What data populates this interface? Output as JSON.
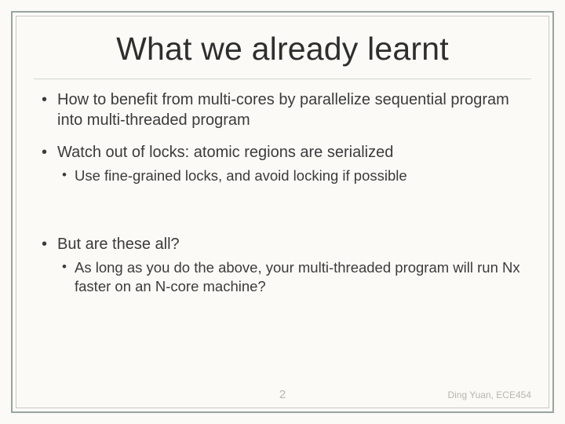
{
  "title": "What we already learnt",
  "bullets": {
    "b1": "How to benefit from multi-cores by parallelize sequential program into multi-threaded program",
    "b2": "Watch out of locks: atomic regions are serialized",
    "b2_sub1": "Use fine-grained locks, and avoid locking if possible",
    "b3": "But are these all?",
    "b3_sub1": "As long as you do the above, your multi-threaded program will run Nx faster on an N-core machine?"
  },
  "footer": {
    "page_number": "2",
    "credit": "Ding Yuan, ECE454"
  }
}
